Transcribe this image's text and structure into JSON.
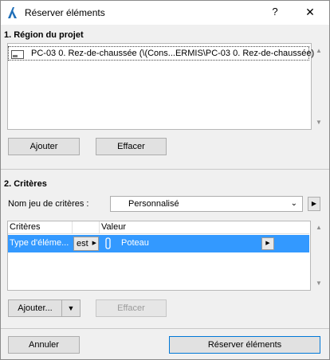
{
  "window": {
    "title": "Réserver éléments",
    "help_label": "?",
    "close_label": "✕"
  },
  "section1": {
    "title": "1. Région du projet",
    "items": [
      {
        "label": "PC-03 0. Rez-de-chaussée (\\(Cons...ERMIS\\PC-03 0. Rez-de-chaussée)"
      }
    ],
    "add_label": "Ajouter",
    "clear_label": "Effacer"
  },
  "section2": {
    "title": "2. Critères",
    "set_label": "Nom jeu de critères :",
    "set_value": "Personnalisé",
    "table": {
      "headers": [
        "Critères",
        "",
        "Valeur"
      ],
      "rows": [
        {
          "criterion": "Type d'éléme...",
          "operator": "est",
          "value": "Poteau"
        }
      ]
    },
    "add_label": "Ajouter...",
    "clear_label": "Effacer"
  },
  "footer": {
    "cancel_label": "Annuler",
    "reserve_label": "Réserver éléments"
  }
}
